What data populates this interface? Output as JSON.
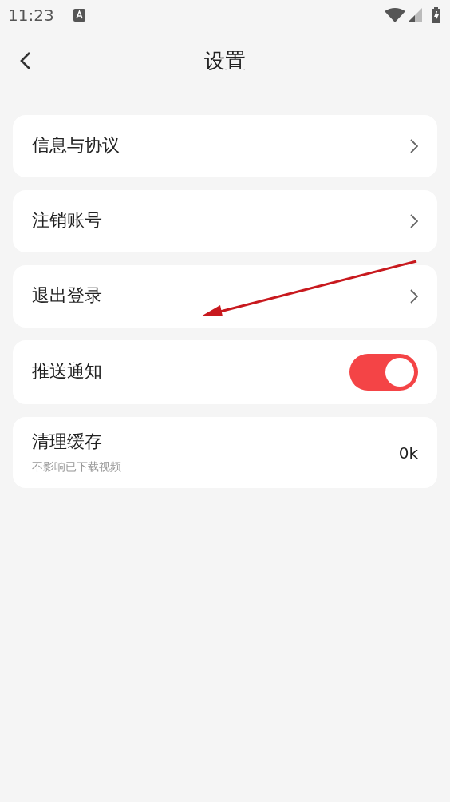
{
  "status_bar": {
    "time": "11:23"
  },
  "header": {
    "title": "设置"
  },
  "items": [
    {
      "kind": "link",
      "label": "信息与协议"
    },
    {
      "kind": "link",
      "label": "注销账号"
    },
    {
      "kind": "link",
      "label": "退出登录"
    },
    {
      "kind": "toggle",
      "label": "推送通知",
      "on": true
    },
    {
      "kind": "value",
      "label": "清理缓存",
      "subtitle": "不影响已下载视频",
      "value": "0k"
    }
  ]
}
